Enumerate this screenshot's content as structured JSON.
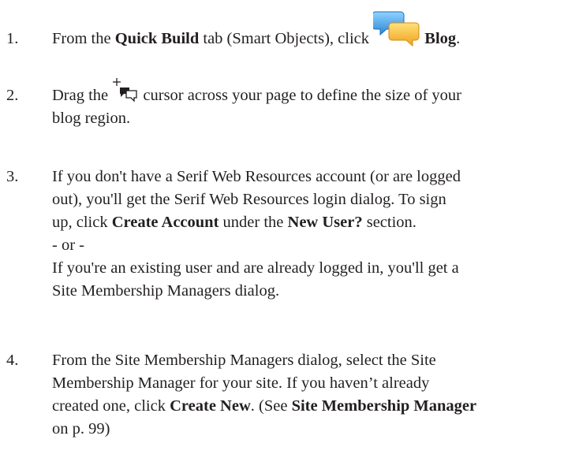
{
  "steps": [
    {
      "number": "1.",
      "before": "From the ",
      "bold1": "Quick Build",
      "mid": " tab (Smart Objects), click ",
      "icon": "blog-speech-bubbles-icon",
      "bold2": "Blog",
      "after": "."
    },
    {
      "number": "2.",
      "before": "Drag the",
      "icon": "blog-cursor-icon",
      "line1_after": "cursor across your page to define the size of your",
      "line2": "blog region."
    },
    {
      "number": "3.",
      "line1": "If you don't have a Serif Web Resources account (or are logged",
      "line2": "out), you'll get the Serif Web Resources login dialog. To sign",
      "line3_before": "up, click ",
      "line3_bold1": "Create Account",
      "line3_mid": " under the ",
      "line3_bold2": "New User?",
      "line3_after": " section.",
      "line4": "- or -",
      "line5": "If you're an existing user and are already logged in, you'll get a",
      "line6": "Site Membership Managers dialog."
    },
    {
      "number": "4.",
      "line1": "From the Site Membership Managers dialog, select the Site",
      "line2": "Membership Manager for your site. If you haven’t already",
      "line3_before": "created one, click ",
      "line3_bold1": "Create New",
      "line3_mid": ". (See ",
      "line3_bold2": "Site Membership Manager",
      "line4": "on p. 99)"
    }
  ]
}
